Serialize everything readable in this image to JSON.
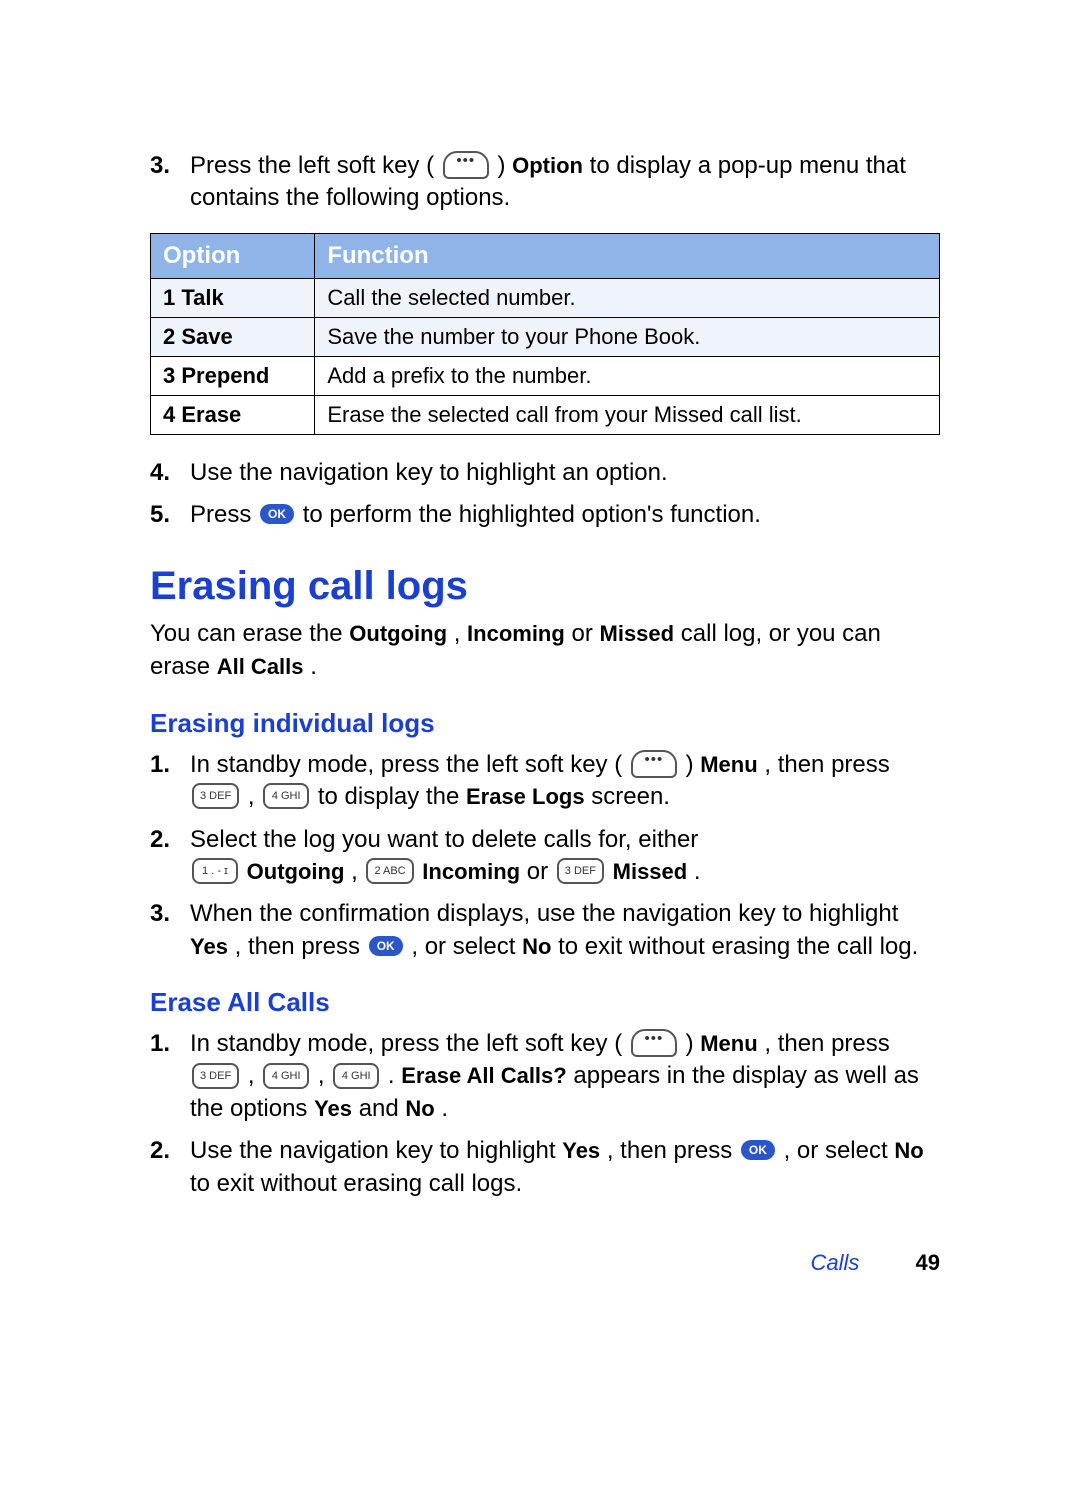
{
  "step3": {
    "num": "3.",
    "text_a": "Press the left soft key (",
    "text_b": ") ",
    "option_label": "Option",
    "text_c": " to display a pop-up menu that contains the following options."
  },
  "table": {
    "head_option": "Option",
    "head_function": "Function",
    "rows": [
      {
        "opt": "1 Talk",
        "fun": "Call the selected number."
      },
      {
        "opt": "2 Save",
        "fun": "Save the number to your Phone Book."
      },
      {
        "opt": "3 Prepend",
        "fun": "Add a prefix to the number."
      },
      {
        "opt": "4 Erase",
        "fun": "Erase the selected call from your Missed call list."
      }
    ]
  },
  "step4": {
    "num": "4.",
    "text": "Use the navigation key to highlight an option."
  },
  "step5": {
    "num": "5.",
    "text_a": "Press ",
    "ok": "OK",
    "text_b": " to perform the highlighted option's function."
  },
  "h1": "Erasing call logs",
  "intro": {
    "a": "You can erase the ",
    "b_outgoing": "Outgoing",
    "c": ", ",
    "b_incoming": "Incoming",
    "d": " or ",
    "b_missed": "Missed",
    "e": " call log, or you can erase ",
    "b_all": "All Calls",
    "f": "."
  },
  "h2a": "Erasing individual logs",
  "ind1": {
    "num": "1.",
    "a": "In standby mode, press the left soft key (",
    "b": ") ",
    "menu": "Menu",
    "c": ", then press ",
    "k3": "3 DEF",
    "comma": ", ",
    "k4": "4 GHI",
    "d": " to display the ",
    "erase_logs": "Erase Logs",
    "e": " screen."
  },
  "ind2": {
    "num": "2.",
    "a": "Select the log you want to delete calls for, either ",
    "k1": "1 . - ɪ",
    "sp": " ",
    "outgoing": "Outgoing",
    "c1": ", ",
    "k2": "2 ABC",
    "incoming": "Incoming",
    "or": " or ",
    "k3": "3 DEF",
    "missed": "Missed",
    "dot": "."
  },
  "ind3": {
    "num": "3.",
    "a": "When the confirmation displays, use the navigation key to highlight ",
    "yes": "Yes",
    "b": ", then press ",
    "ok": "OK",
    "c": ", or select ",
    "no": "No",
    "d": " to exit without erasing the call log."
  },
  "h2b": "Erase All Calls",
  "all1": {
    "num": "1.",
    "a": "In standby mode, press the left soft key (",
    "b": ") ",
    "menu": "Menu",
    "c": ", then press ",
    "k3": "3 DEF",
    "comma1": ", ",
    "k4a": "4 GHI",
    "comma2": ", ",
    "k4b": "4 GHI",
    "d": ". ",
    "erase_all_q": "Erase All Calls?",
    "e": " appears in the display as well as the options ",
    "yes": "Yes",
    "and": " and ",
    "no": "No",
    "dot": "."
  },
  "all2": {
    "num": "2.",
    "a": "Use the navigation key to highlight ",
    "yes": "Yes",
    "b": ", then press ",
    "ok": "OK",
    "c": ", or select ",
    "no": "No",
    "d": " to exit without erasing call logs."
  },
  "footer": {
    "chapter": "Calls",
    "page": "49"
  }
}
